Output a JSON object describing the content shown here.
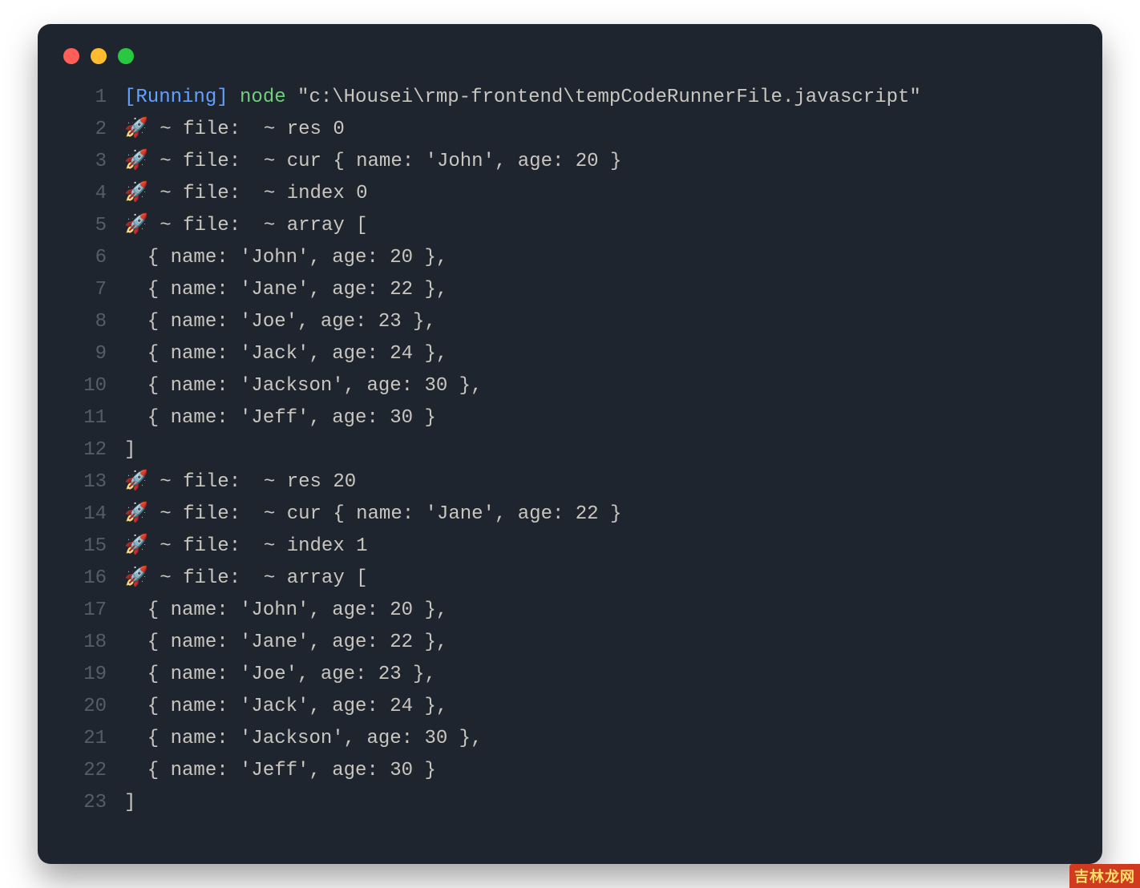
{
  "window": {
    "traffic": {
      "red": "#ff5f57",
      "yellow": "#febc2e",
      "green": "#28c840"
    }
  },
  "watermark": "吉林龙网",
  "terminal": {
    "running_label": "[Running]",
    "command": "node",
    "path": "\"c:\\Housei\\rmp-frontend\\tempCodeRunnerFile.javascript\"",
    "lines": [
      "🚀 ~ file:  ~ res 0",
      "🚀 ~ file:  ~ cur { name: 'John', age: 20 }",
      "🚀 ~ file:  ~ index 0",
      "🚀 ~ file:  ~ array [",
      "  { name: 'John', age: 20 },",
      "  { name: 'Jane', age: 22 },",
      "  { name: 'Joe', age: 23 },",
      "  { name: 'Jack', age: 24 },",
      "  { name: 'Jackson', age: 30 },",
      "  { name: 'Jeff', age: 30 }",
      "]",
      "🚀 ~ file:  ~ res 20",
      "🚀 ~ file:  ~ cur { name: 'Jane', age: 22 }",
      "🚀 ~ file:  ~ index 1",
      "🚀 ~ file:  ~ array [",
      "  { name: 'John', age: 20 },",
      "  { name: 'Jane', age: 22 },",
      "  { name: 'Joe', age: 23 },",
      "  { name: 'Jack', age: 24 },",
      "  { name: 'Jackson', age: 30 },",
      "  { name: 'Jeff', age: 30 }",
      "]"
    ]
  }
}
